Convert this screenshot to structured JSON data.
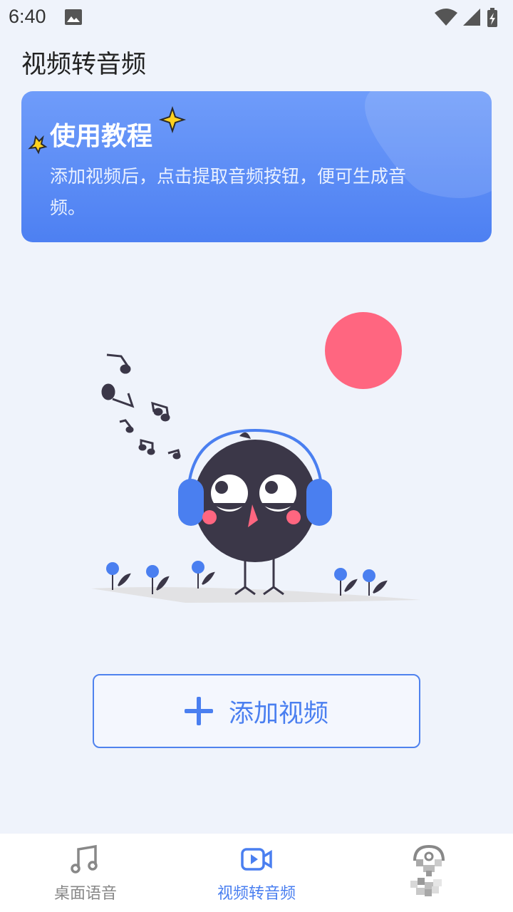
{
  "status": {
    "time": "6:40"
  },
  "page": {
    "title": "视频转音频"
  },
  "tutorial": {
    "title": "使用教程",
    "description": "添加视频后，点击提取音频按钮，便可生成音频。"
  },
  "actions": {
    "add_video": "添加视频"
  },
  "bottom_nav": {
    "items": [
      {
        "label": "桌面语音",
        "icon": "music-note-icon",
        "active": false
      },
      {
        "label": "视频转音频",
        "icon": "video-icon",
        "active": true
      },
      {
        "label": "",
        "icon": "profile-icon",
        "active": false
      }
    ]
  },
  "colors": {
    "accent": "#4a7ff0",
    "background": "#eff3fb",
    "sun": "#ff6680",
    "bird": "#3b3748"
  }
}
